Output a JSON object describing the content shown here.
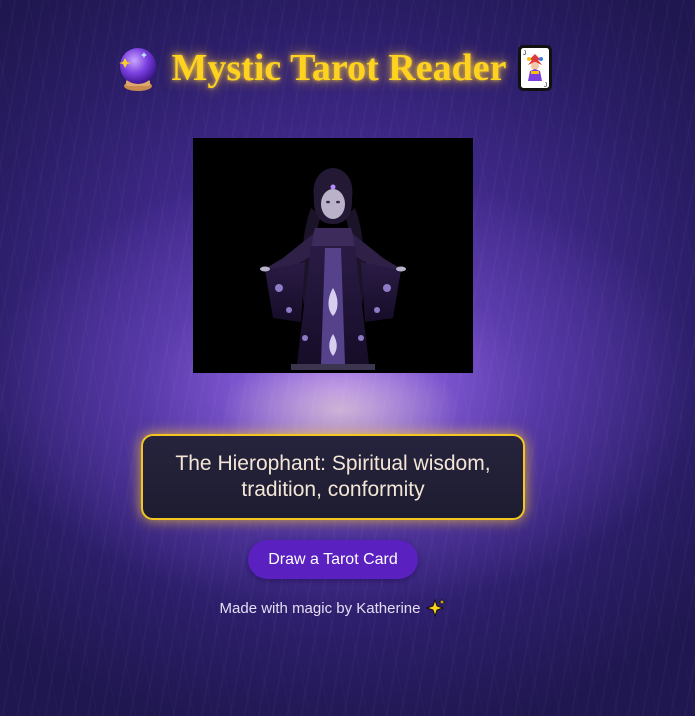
{
  "header": {
    "title": "Mystic Tarot Reader",
    "left_icon": "crystal-ball-icon",
    "right_icon": "joker-card-icon"
  },
  "card": {
    "image_icon": "hierophant-figure-illustration"
  },
  "reading": {
    "text": "The Hierophant: Spiritual wisdom, tradition, conformity"
  },
  "actions": {
    "draw_label": "Draw a Tarot Card"
  },
  "footer": {
    "text": "Made with magic by Katherine",
    "icon": "sparkles-icon"
  },
  "colors": {
    "title": "#ffd21f",
    "button": "#5a20c0",
    "reading_border": "#f3c623",
    "reading_bg": "#1d1c30",
    "background": "#2a1d66"
  }
}
